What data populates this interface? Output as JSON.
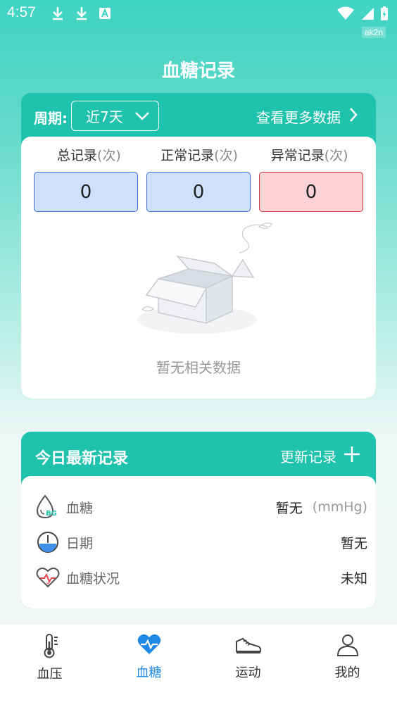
{
  "status_bar": {
    "time": "4:57",
    "tag": "ak2n",
    "icons": [
      "download-icon",
      "download-icon",
      "keyboard-a-icon",
      "wifi-icon",
      "signal-icon",
      "battery-charging-icon"
    ]
  },
  "page_title": "血糖记录",
  "summary_card": {
    "period_label": "周期:",
    "period_value": "近7天",
    "view_more": "查看更多数据",
    "stats": [
      {
        "label": "总记录",
        "unit": "(次)",
        "value": "0",
        "kind": "normal"
      },
      {
        "label": "正常记录",
        "unit": "(次)",
        "value": "0",
        "kind": "normal"
      },
      {
        "label": "异常记录",
        "unit": "(次)",
        "value": "0",
        "kind": "abnormal"
      }
    ],
    "empty_text": "暂无相关数据"
  },
  "today_card": {
    "title": "今日最新记录",
    "update_label": "更新记录",
    "rows": [
      {
        "label": "血糖",
        "value": "暂无",
        "unit": "(mmHg)",
        "icon": "blood-drop-bg-icon"
      },
      {
        "label": "日期",
        "value": "暂无",
        "unit": "",
        "icon": "clock-icon"
      },
      {
        "label": "血糖状况",
        "value": "未知",
        "unit": "",
        "icon": "heart-pulse-icon"
      }
    ]
  },
  "tabbar": {
    "tabs": [
      {
        "label": "血压",
        "icon": "thermometer-icon",
        "active": false
      },
      {
        "label": "血糖",
        "icon": "heartbeat-icon",
        "active": true
      },
      {
        "label": "运动",
        "icon": "sneaker-icon",
        "active": false
      },
      {
        "label": "我的",
        "icon": "user-icon",
        "active": false
      }
    ]
  },
  "colors": {
    "primary_teal": "#1fc3ad",
    "active_tab": "#1e88e5",
    "normal_box_bg": "#cfe0fb",
    "abnormal_box_bg": "#fbd3d6"
  }
}
